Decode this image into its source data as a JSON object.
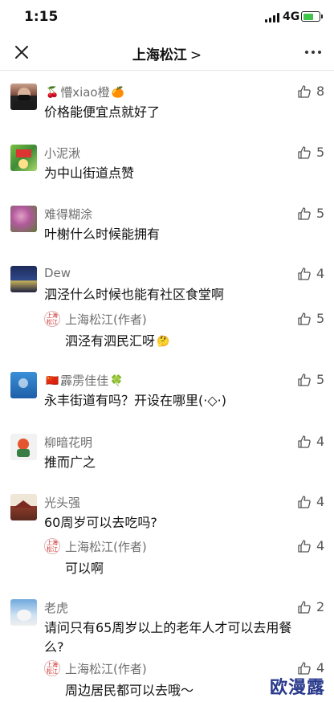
{
  "status_bar": {
    "time": "1:15",
    "network": "4G"
  },
  "nav": {
    "title": "上海松江",
    "chevron": ">"
  },
  "comments": [
    {
      "name": "懵xiao橙",
      "content": "价格能便宜点就好了",
      "likes": "8"
    },
    {
      "name": "小泥湫",
      "content": "为中山街道点赞",
      "likes": "5"
    },
    {
      "name": "难得糊涂",
      "content": "叶榭什么时候能拥有",
      "likes": "5"
    },
    {
      "name": "Dew",
      "content": "泗泾什么时候也能有社区食堂啊",
      "likes": "4",
      "reply": {
        "name": "上海松江(作者)",
        "content": "泗泾有泗民汇呀",
        "likes": "5"
      }
    },
    {
      "name": "霹雳佳佳",
      "content": "永丰街道有吗？开设在哪里(·◇·)",
      "likes": "5"
    },
    {
      "name": "柳暗花明",
      "content": "推而广之",
      "likes": "4"
    },
    {
      "name": "光头强",
      "content": "60周岁可以去吃吗?",
      "likes": "4",
      "reply": {
        "name": "上海松江(作者)",
        "content": "可以啊",
        "likes": "4"
      }
    },
    {
      "name": "老虎",
      "content": "请问只有65周岁以上的老年人才可以去用餐么?",
      "likes": "2",
      "reply": {
        "name": "上海松江(作者)",
        "content": "周边居民都可以去哦～",
        "likes": "4"
      }
    }
  ],
  "author_avatar_text": "上海松江",
  "watermark": "欧漫露",
  "colors": {
    "name": "#6e6e6e",
    "battery": "#41c44b",
    "watermark": "#2a3a8c"
  },
  "icons": [
    "close-icon",
    "more-icon",
    "thumb-up-icon",
    "signal-icon",
    "battery-icon"
  ]
}
